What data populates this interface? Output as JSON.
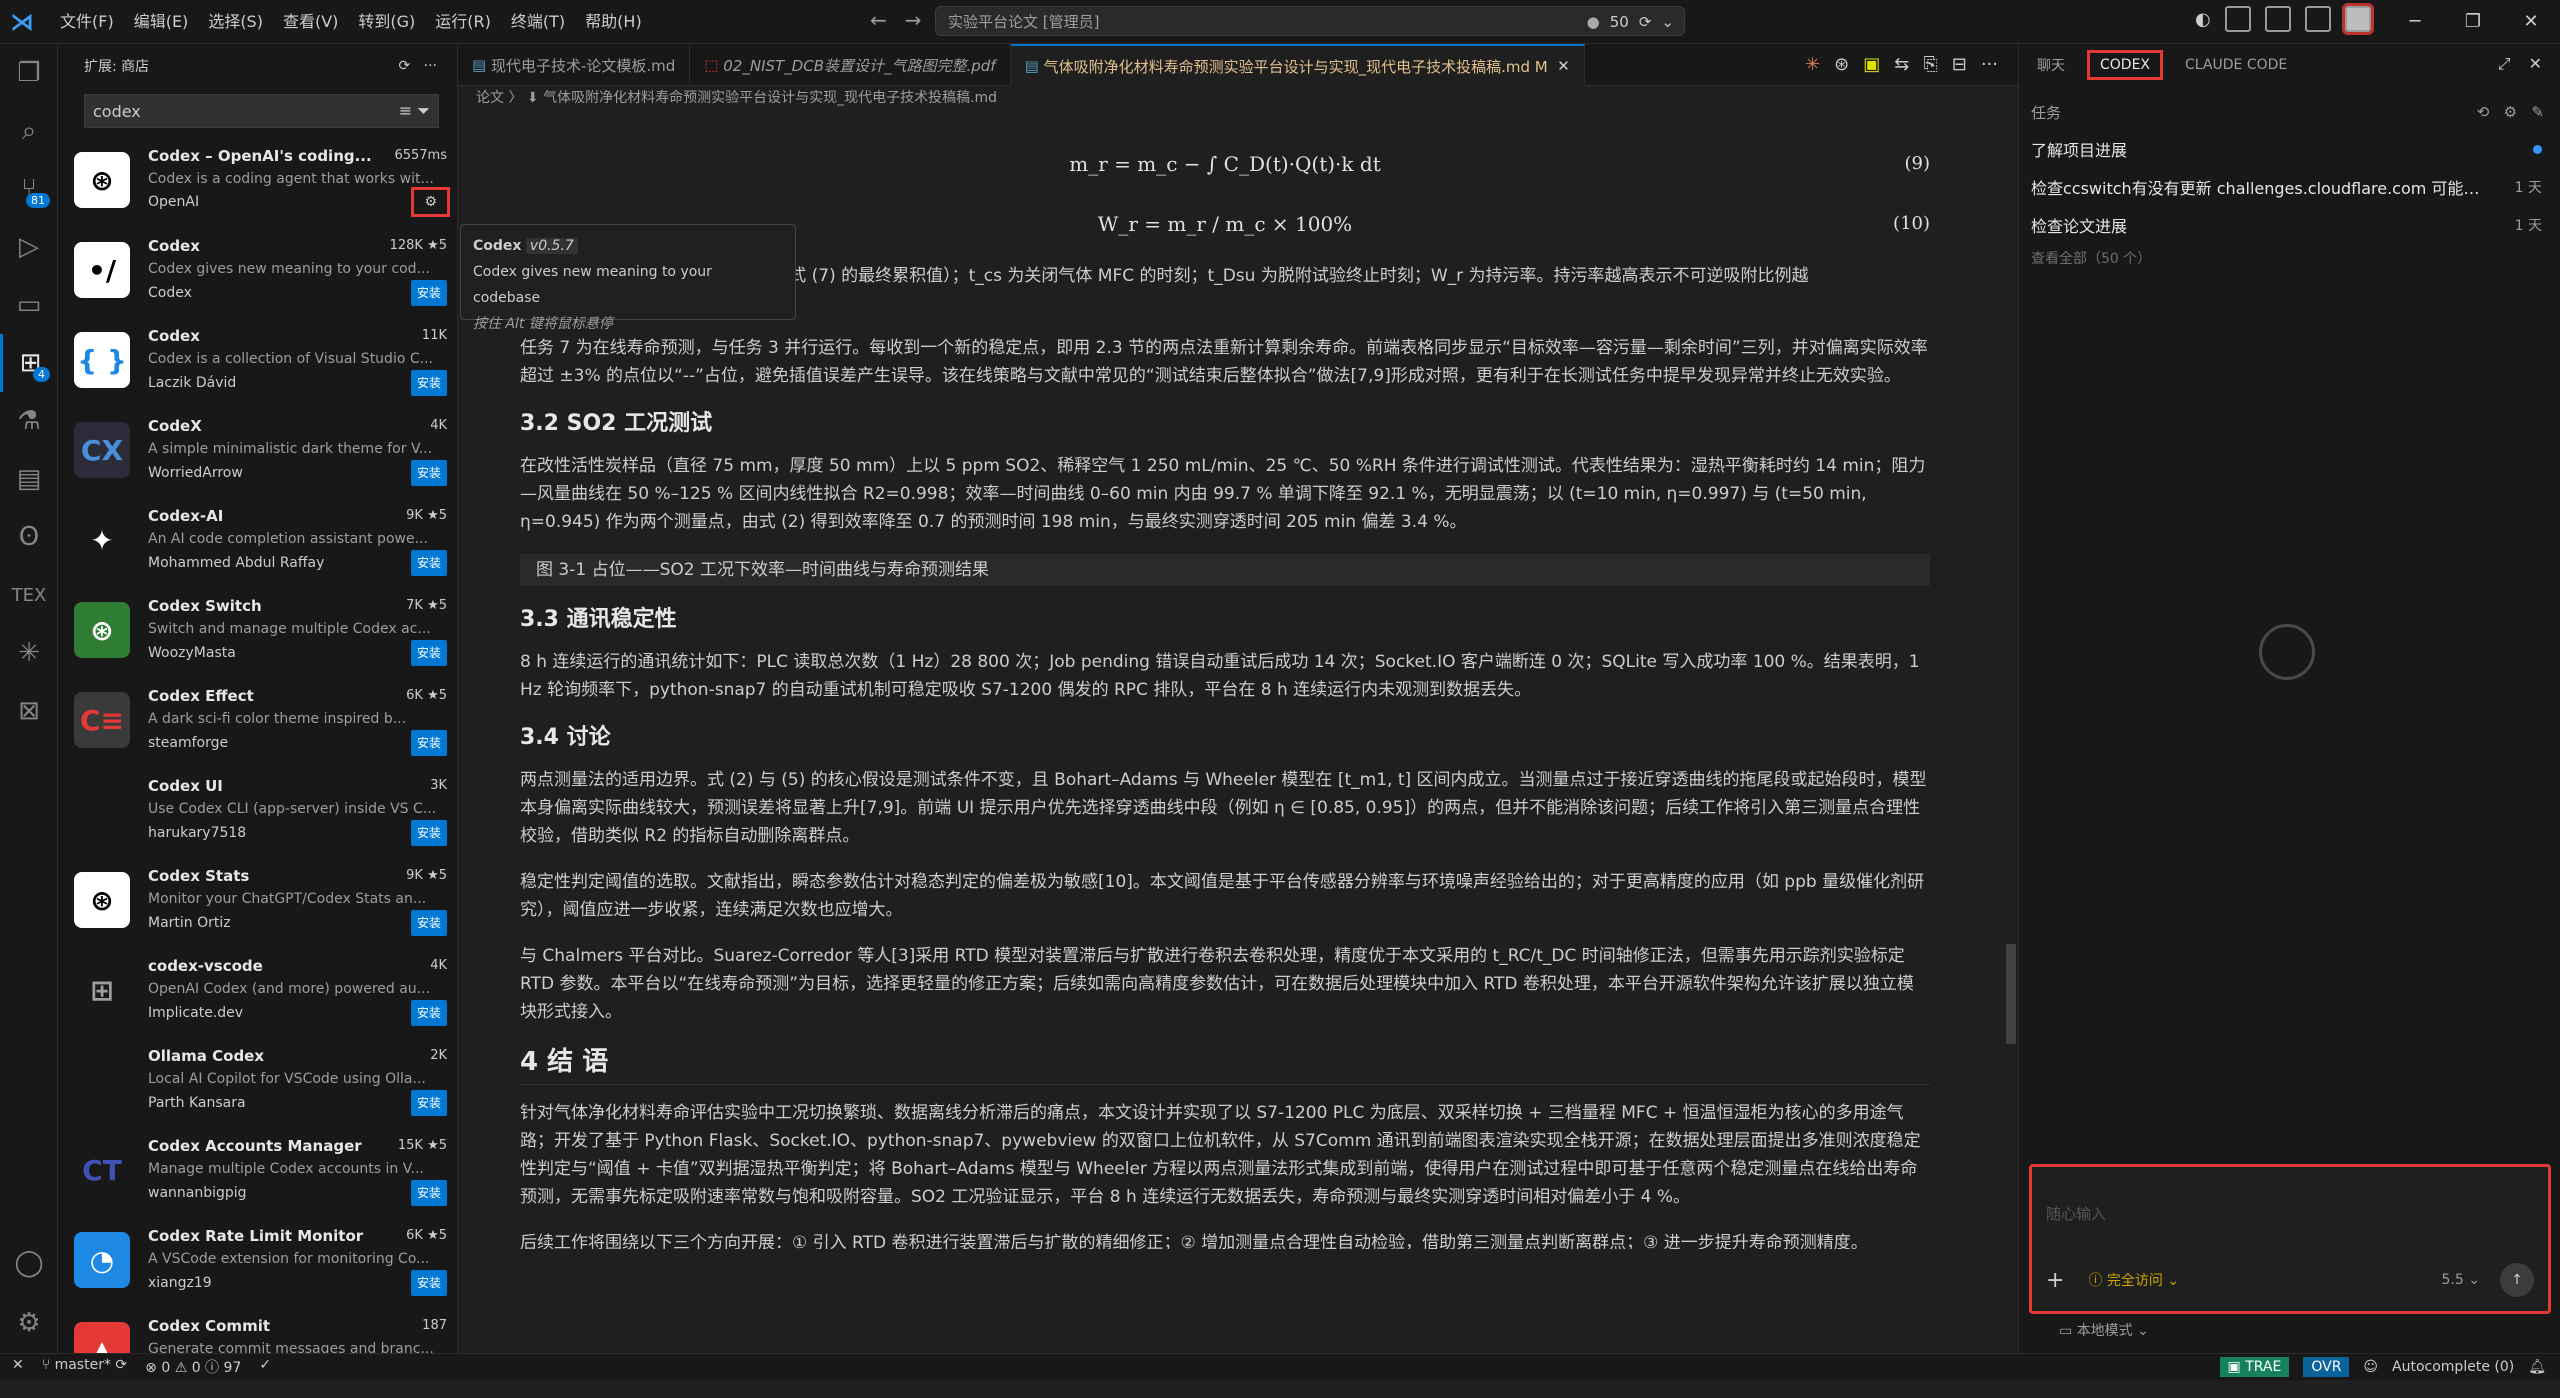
{
  "menu": [
    "文件(F)",
    "编辑(E)",
    "选择(S)",
    "查看(V)",
    "转到(G)",
    "运行(R)",
    "终端(T)",
    "帮助(H)"
  ],
  "command_center": "实验平台论文 [管理员]",
  "cc_count": "50",
  "sidebar": {
    "title": "扩展: 商店",
    "search": "codex",
    "extensions": [
      {
        "name": "Codex – OpenAI's coding...",
        "stat": "6557ms",
        "desc": "Codex is a coding agent that works wit...",
        "publisher": "OpenAI",
        "icon": "openai-icon",
        "bg": "#ffffff",
        "fg": "#000000",
        "install": ""
      },
      {
        "name": "Codex",
        "stat": "128K ★5",
        "desc": "Codex gives new meaning to your cod...",
        "publisher": "Codex",
        "icon": "codex-slash-icon",
        "bg": "#ffffff",
        "fg": "#000000",
        "install": "安装"
      },
      {
        "name": "Codex",
        "stat": "11K",
        "desc": "Codex is a collection of Visual Studio C...",
        "publisher": "Laczik Dávid",
        "icon": "braces-icon",
        "bg": "#ffffff",
        "fg": "#1e88e5",
        "install": "安装"
      },
      {
        "name": "CodeX",
        "stat": "4K",
        "desc": "A simple minimalistic dark theme for V...",
        "publisher": "WorriedArrow",
        "icon": "codex-theme-icon",
        "bg": "#2b2b3a",
        "fg": "#4a90d9",
        "install": "安装"
      },
      {
        "name": "Codex-AI",
        "stat": "9K ★5",
        "desc": "An AI code completion assistant powe...",
        "publisher": "Mohammed Abdul Raffay",
        "icon": "sparkle-icon",
        "bg": "#181818",
        "fg": "#ffffff",
        "install": "安装"
      },
      {
        "name": "Codex Switch",
        "stat": "7K ★5",
        "desc": "Switch and manage multiple Codex ac...",
        "publisher": "WoozyMasta",
        "icon": "openai-switch-icon",
        "bg": "#2e7d32",
        "fg": "#ffffff",
        "install": "安装"
      },
      {
        "name": "Codex Effect",
        "stat": "6K ★5",
        "desc": "A dark sci-fi color theme inspired b...",
        "publisher": "steamforge",
        "icon": "effect-icon",
        "bg": "#3a3a3a",
        "fg": "#e53935",
        "install": "安装"
      },
      {
        "name": "Codex UI",
        "stat": "3K",
        "desc": "Use Codex CLI (app-server) inside VS C...",
        "publisher": "harukary7518",
        "icon": "blank-icon",
        "bg": "#181818",
        "fg": "#181818",
        "install": "安装"
      },
      {
        "name": "Codex Stats",
        "stat": "9K ★5",
        "desc": "Monitor your ChatGPT/Codex Stats an...",
        "publisher": "Martin Ortiz",
        "icon": "openai-stats-icon",
        "bg": "#ffffff",
        "fg": "#000000",
        "install": "安装"
      },
      {
        "name": "codex-vscode",
        "stat": "4K",
        "desc": "OpenAI Codex (and more) powered au...",
        "publisher": "Implicate.dev",
        "icon": "blocks-icon",
        "bg": "#181818",
        "fg": "#9d9d9d",
        "install": "安装"
      },
      {
        "name": "Ollama Codex",
        "stat": "2K",
        "desc": "Local AI Copilot for VSCode using Olla...",
        "publisher": "Parth Kansara",
        "icon": "blank-icon",
        "bg": "#181818",
        "fg": "#181818",
        "install": "安装"
      },
      {
        "name": "Codex Accounts Manager",
        "stat": "15K ★5",
        "desc": "Manage multiple Codex accounts in V...",
        "publisher": "wannanbigpig",
        "icon": "ct-icon",
        "bg": "#181818",
        "fg": "#3f51b5",
        "install": "安装"
      },
      {
        "name": "Codex Rate Limit Monitor",
        "stat": "6K ★5",
        "desc": "A VSCode extension for monitoring Co...",
        "publisher": "xiangz19",
        "icon": "gauge-icon",
        "bg": "#1e88e5",
        "fg": "#ffffff",
        "install": "安装"
      },
      {
        "name": "Codex Commit",
        "stat": "187",
        "desc": "Generate commit messages and branc...",
        "publisher": "",
        "icon": "commit-icon",
        "bg": "#e53935",
        "fg": "#ffffff",
        "install": ""
      }
    ]
  },
  "tooltip": {
    "title": "Codex",
    "version": "v0.5.7",
    "desc": "Codex gives new meaning to your codebase",
    "hint": "按住 Alt 键将鼠标悬停"
  },
  "tabs": [
    "现代电子技术-论文模板.md",
    "02_NIST_DCB装置设计_气路图完整.pdf",
    "气体吸附净化材料寿命预测实验平台设计与实现_现代电子技术投稿稿.md  M"
  ],
  "breadcrumb": "论文 〉 ⬇ 气体吸附净化材料寿命预测实验平台设计与实现_现代电子技术投稿稿.md",
  "doc": {
    "eq9": "m_r = m_c − ∫ C_D(t)·Q(t)·k dt",
    "eq9n": "(9)",
    "eq10": "W_r = m_r / m_c × 100%",
    "eq10n": "(10)",
    "p0": "式中：m_r 为剩余持污量（g，来自式 (7) 的最终累积值）；t_cs 为关闭气体 MFC 的时刻；t_Dsu 为脱附试验终止时刻；W_r 为持污率。持污率越高表示不可逆吸附比例越",
    "p1": "任务 7 为在线寿命预测，与任务 3 并行运行。每收到一个新的稳定点，即用 2.3 节的两点法重新计算剩余寿命。前端表格同步显示“目标效率—容污量—剩余时间”三列，并对偏离实际效率超过 ±3% 的点位以“--”占位，避免插值误差产生误导。该在线策略与文献中常见的“测试结束后整体拟合”做法[7,9]形成对照，更有利于在长测试任务中提早发现异常并终止无效实验。",
    "h32": "3.2 SO2 工况测试",
    "p2": "在改性活性炭样品（直径 75 mm，厚度 50 mm）上以 5 ppm SO2、稀释空气 1 250 mL/min、25 ℃、50 %RH 条件进行调试性测试。代表性结果为：湿热平衡耗时约 14 min；阻力—风量曲线在 50 %–125 % 区间内线性拟合 R2=0.998；效率—时间曲线 0–60 min 内由 99.7 % 单调下降至 92.1 %，无明显震荡；以 (t=10 min, η=0.997) 与 (t=50 min, η=0.945) 作为两个测量点，由式 (2) 得到效率降至 0.7 的预测时间 198 min，与最终实测穿透时间 205 min 偏差 3.4 %。",
    "fig": "图 3-1 占位——SO2 工况下效率—时间曲线与寿命预测结果",
    "h33": "3.3 通讯稳定性",
    "p3": "8 h 连续运行的通讯统计如下：PLC 读取总次数（1 Hz）28 800 次；Job pending 错误自动重试后成功 14 次；Socket.IO 客户端断连 0 次；SQLite 写入成功率 100 %。结果表明，1 Hz 轮询频率下，python-snap7 的自动重试机制可稳定吸收 S7-1200 偶发的 RPC 排队，平台在 8 h 连续运行内未观测到数据丢失。",
    "h34": "3.4 讨论",
    "p4": "两点测量法的适用边界。式 (2) 与 (5) 的核心假设是测试条件不变，且 Bohart–Adams 与 Wheeler 模型在 [t_m1, t] 区间内成立。当测量点过于接近穿透曲线的拖尾段或起始段时，模型本身偏离实际曲线较大，预测误差将显著上升[7,9]。前端 UI 提示用户优先选择穿透曲线中段（例如 η ∈ [0.85, 0.95]）的两点，但并不能消除该问题；后续工作将引入第三测量点合理性校验，借助类似 R2 的指标自动删除离群点。",
    "p5": "稳定性判定阈值的选取。文献指出，瞬态参数估计对稳态判定的偏差极为敏感[10]。本文阈值是基于平台传感器分辨率与环境噪声经验给出的；对于更高精度的应用（如 ppb 量级催化剂研究），阈值应进一步收紧，连续满足次数也应增大。",
    "p6": "与 Chalmers 平台对比。Suarez-Corredor 等人[3]采用 RTD 模型对装置滞后与扩散进行卷积去卷积处理，精度优于本文采用的 t_RC/t_DC 时间轴修正法，但需事先用示踪剂实验标定 RTD 参数。本平台以“在线寿命预测”为目标，选择更轻量的修正方案；后续如需向高精度参数估计，可在数据后处理模块中加入 RTD 卷积处理，本平台开源软件架构允许该扩展以独立模块形式接入。",
    "h4": "4 结 语",
    "p7": "针对气体净化材料寿命评估实验中工况切换繁琐、数据离线分析滞后的痛点，本文设计并实现了以 S7-1200 PLC 为底层、双采样切换 + 三档量程 MFC + 恒温恒湿柜为核心的多用途气路；开发了基于 Python Flask、Socket.IO、python-snap7、pywebview 的双窗口上位机软件，从 S7Comm 通讯到前端图表渲染实现全栈开源；在数据处理层面提出多准则浓度稳定性判定与“阈值 + 卡值”双判据湿热平衡判定；将 Bohart–Adams 模型与 Wheeler 方程以两点测量法形式集成到前端，使得用户在测试过程中即可基于任意两个稳定测量点在线给出寿命预测，无需事先标定吸附速率常数与饱和吸附容量。SO2 工况验证显示，平台 8 h 连续运行无数据丢失，寿命预测与最终实测穿透时间相对偏差小于 4 %。",
    "p8": "后续工作将围绕以下三个方向开展：① 引入 RTD 卷积进行装置滞后与扩散的精细修正；② 增加测量点合理性自动检验，借助第三测量点判断离群点；③ 进一步提升寿命预测精度。"
  },
  "panel": {
    "tabs": [
      "聊天",
      "CODEX",
      "CLAUDE CODE"
    ],
    "tasks_label": "任务",
    "tasks": [
      {
        "t": "了解项目进展",
        "a": ""
      },
      {
        "t": "检查ccswitch有没有更新 challenges.cloudflare.com 可能存...",
        "a": "1 天"
      },
      {
        "t": "检查论文进展",
        "a": "1 天"
      }
    ],
    "view_all": "查看全部（50 个）",
    "placeholder": "随心输入",
    "access": "完全访问",
    "model": "5.5",
    "local": "本地模式"
  },
  "status": {
    "branch": "master*",
    "problems": "⊗ 0 ⚠ 0 ⓘ 97",
    "trae": "TRAE",
    "ovr": "OVR",
    "autocomplete": "Autocomplete (0)"
  }
}
